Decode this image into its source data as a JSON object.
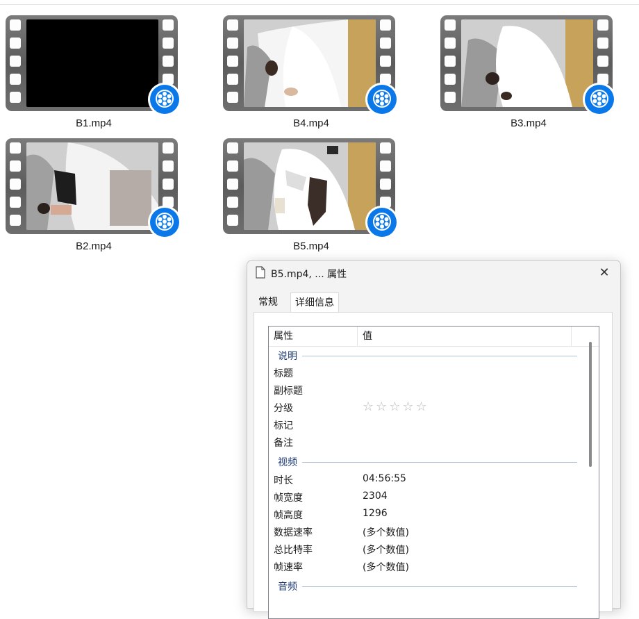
{
  "files": [
    {
      "name": "B1.mp4"
    },
    {
      "name": "B4.mp4"
    },
    {
      "name": "B3.mp4"
    },
    {
      "name": "B2.mp4"
    },
    {
      "name": "B5.mp4"
    }
  ],
  "dialog": {
    "title": "B5.mp4, ... 属性",
    "close_glyph": "✕",
    "tabs": [
      "常规",
      "详细信息"
    ],
    "columns": {
      "property": "属性",
      "value": "值"
    },
    "groups": {
      "description": "说明",
      "video": "视频",
      "audio": "音频"
    },
    "description_rows": [
      {
        "key": "标题",
        "value": ""
      },
      {
        "key": "副标题",
        "value": ""
      },
      {
        "key": "分级",
        "value": ""
      },
      {
        "key": "标记",
        "value": ""
      },
      {
        "key": "备注",
        "value": ""
      }
    ],
    "rating": {
      "stars_text": "☆☆☆☆☆",
      "value": 0,
      "max": 5
    },
    "video_rows": [
      {
        "key": "时长",
        "value": "04:56:55"
      },
      {
        "key": "帧宽度",
        "value": "2304"
      },
      {
        "key": "帧高度",
        "value": "1296"
      },
      {
        "key": "数据速率",
        "value": "(多个数值)"
      },
      {
        "key": "总比特率",
        "value": "(多个数值)"
      },
      {
        "key": "帧速率",
        "value": "(多个数值)"
      }
    ]
  },
  "colors": {
    "accent": "#1e3c78",
    "quicktime_blue": "#0a78e8"
  }
}
